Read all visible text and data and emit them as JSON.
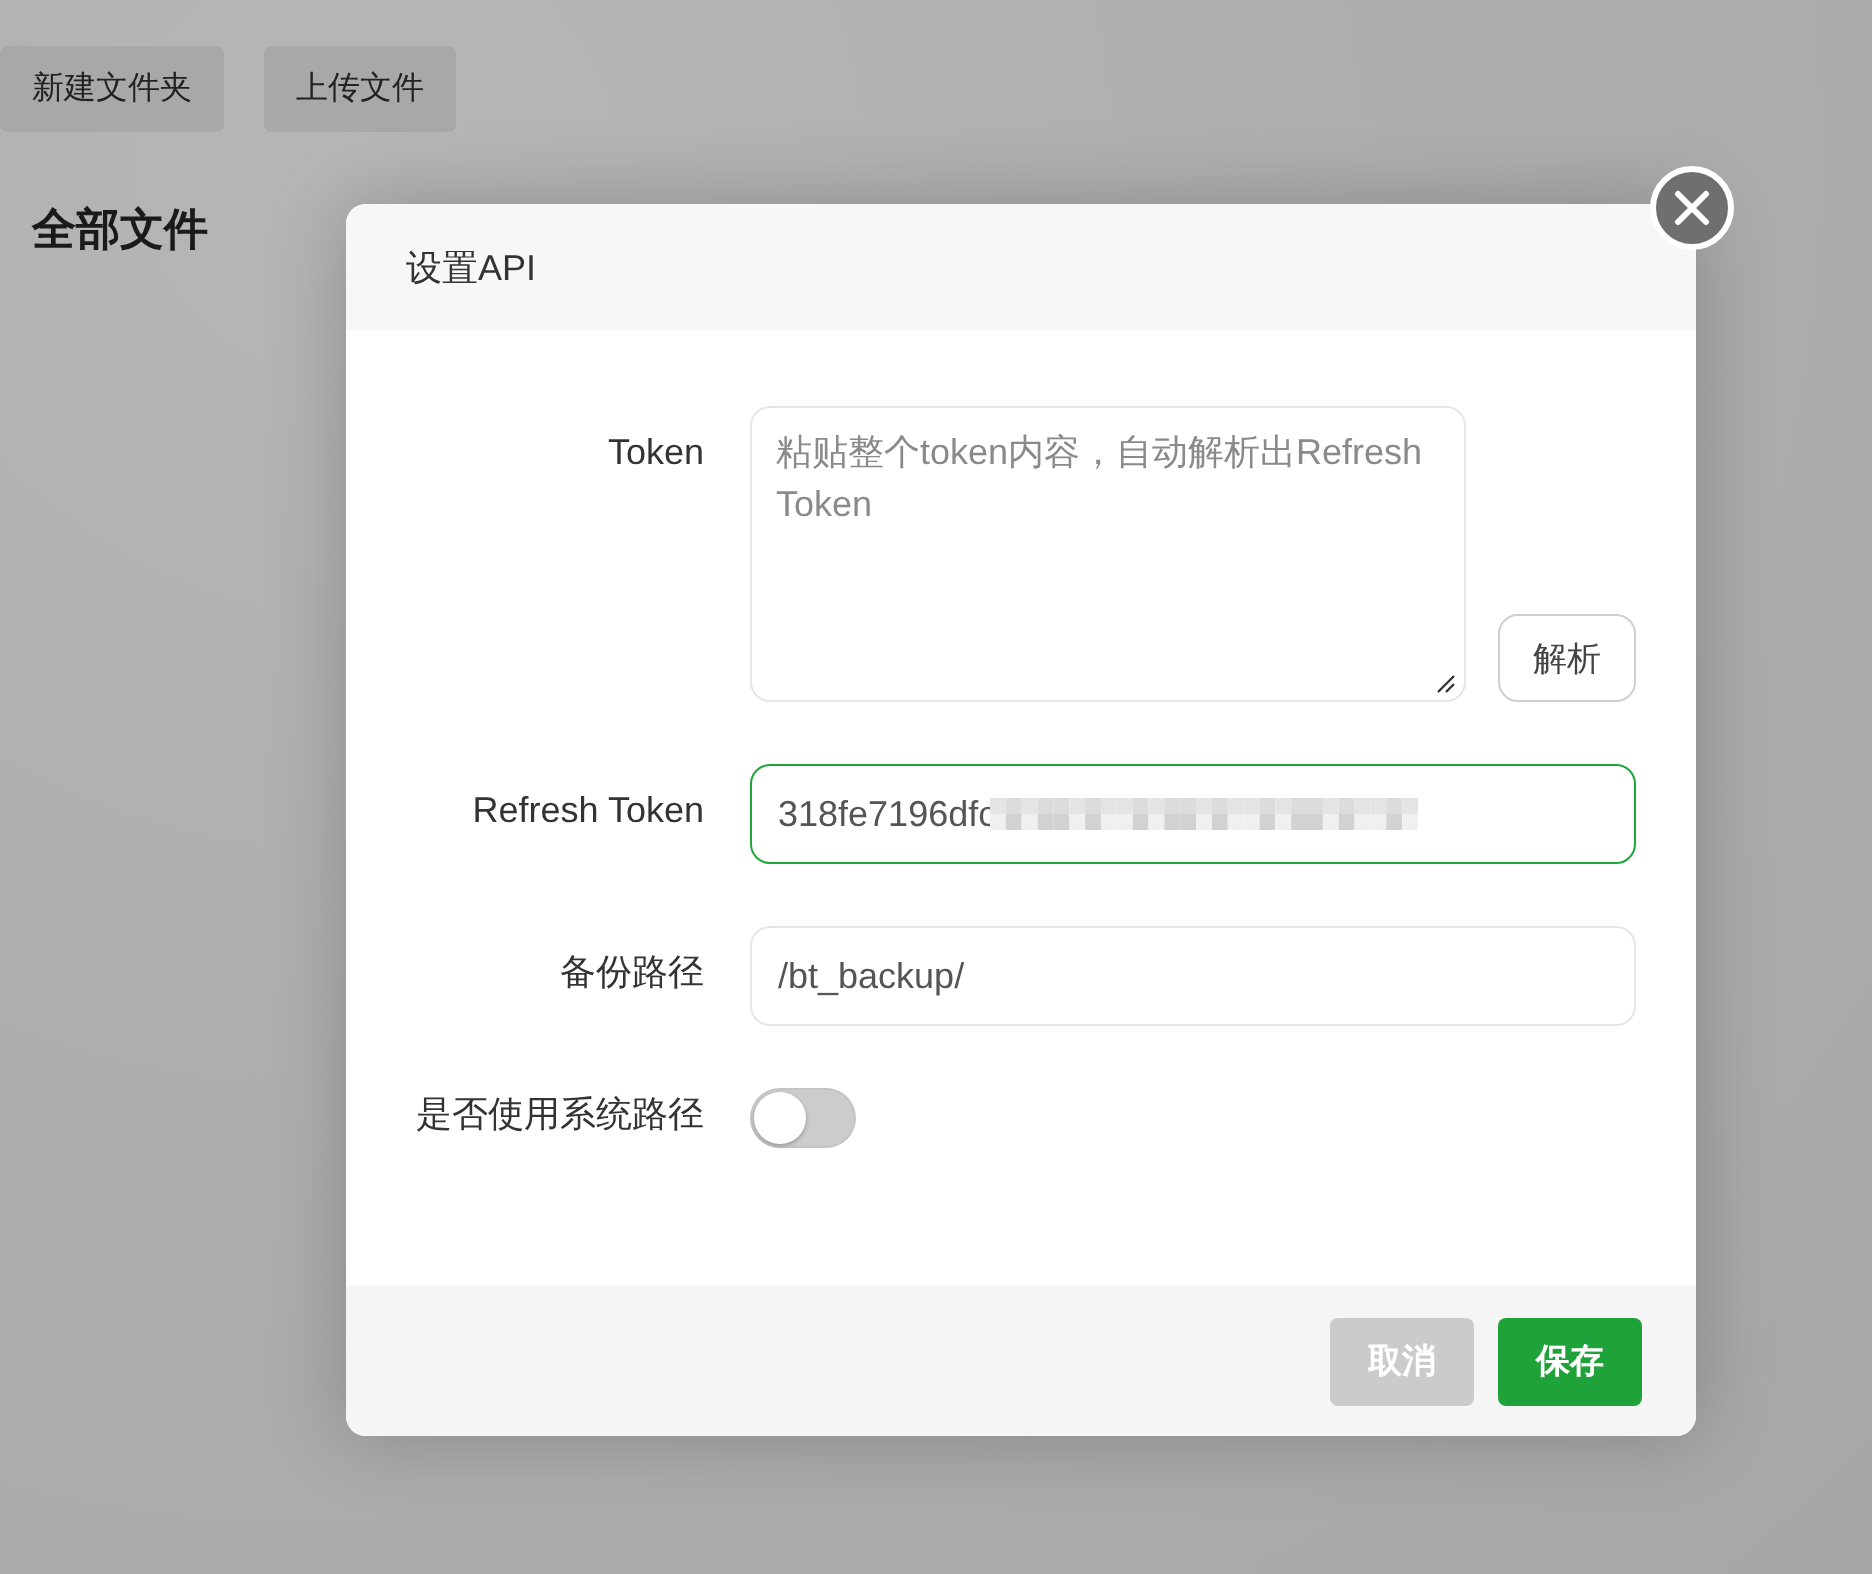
{
  "toolbar": {
    "buttons": [
      "新建文件夹",
      "上传文件"
    ]
  },
  "page_title": "全部文件",
  "dialog": {
    "title": "设置API",
    "fields": [
      {
        "kind": "textarea",
        "label": "Token",
        "placeholder": "粘贴整个token内容，自动解析出Refresh Token",
        "button": "解析"
      },
      {
        "kind": "input",
        "label": "Refresh Token",
        "value": "318fe7196dfc",
        "focused": true,
        "redacted": true
      },
      {
        "kind": "input",
        "label": "备份路径",
        "value": "/bt_backup/",
        "focused": false
      },
      {
        "kind": "toggle",
        "label": "是否使用系统路径",
        "on": false
      }
    ],
    "buttons": [
      {
        "label": "取消",
        "kind": "cancel"
      },
      {
        "label": "保存",
        "kind": "primary"
      }
    ]
  }
}
